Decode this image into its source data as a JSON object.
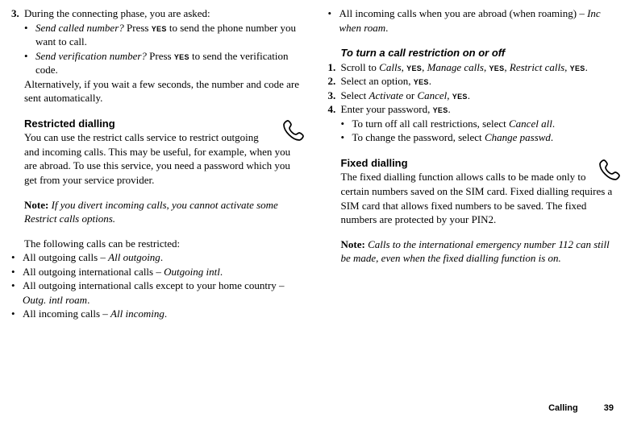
{
  "yes_label": "YES",
  "left": {
    "step3_num": "3.",
    "step3_lead": "During the connecting phase, you are asked:",
    "step3_b1_q": "Send called number?",
    "step3_b1_rest_a": " Press ",
    "step3_b1_rest_b": " to send the phone number you want to call.",
    "step3_b2_q": "Send verification number?",
    "step3_b2_rest_a": " Press ",
    "step3_b2_rest_b": " to send the verification code.",
    "step3_alt": "Alternatively, if you wait a few seconds, the number and code are sent automatically.",
    "rd_heading": "Restricted dialling",
    "rd_body": "You can use the restrict calls service to restrict outgoing and incoming calls. This may be useful, for example, when you are abroad. To use this service, you need a password which you get from your service provider.",
    "rd_note_label": "Note:",
    "rd_note_text": " If you divert incoming calls, you cannot activate some Restrict calls options.",
    "rd_list_intro": "The following calls can be restricted:",
    "rd_items": [
      {
        "t": "All outgoing calls – ",
        "i": "All outgoing",
        "end": "."
      },
      {
        "t": "All outgoing international calls – ",
        "i": "Outgoing intl",
        "end": "."
      },
      {
        "t": "All outgoing international calls except to your home country – ",
        "i": "Outg. intl roam",
        "end": "."
      },
      {
        "t": "All incoming calls – ",
        "i": "All incoming",
        "end": "."
      }
    ]
  },
  "right": {
    "roam_t": "All incoming calls when you are abroad (when roaming) – ",
    "roam_i": "Inc when roam",
    "roam_end": ".",
    "proc_heading": "To turn a call restriction on or off",
    "s1_num": "1.",
    "s1_a": "Scroll to ",
    "s1_calls": "Calls",
    "s1_b": ", ",
    "s1_manage": "Manage calls",
    "s1_c": ", ",
    "s1_restrict": "Restrict calls",
    "s1_d": ", ",
    "s1_end": ".",
    "s2_num": "2.",
    "s2_a": "Select an option, ",
    "s2_end": ".",
    "s3_num": "3.",
    "s3_a": "Select ",
    "s3_activate": "Activate",
    "s3_or": " or ",
    "s3_cancel": "Cancel",
    "s3_c": ", ",
    "s3_end": ".",
    "s4_num": "4.",
    "s4_a": "Enter your password, ",
    "s4_end": ".",
    "s4_sub1_a": "To turn off all call restrictions, select ",
    "s4_sub1_i": "Cancel all",
    "s4_sub1_end": ".",
    "s4_sub2_a": "To change the password, select ",
    "s4_sub2_i": "Change passwd",
    "s4_sub2_end": ".",
    "fd_heading": "Fixed dialling",
    "fd_body": "The fixed dialling function allows calls to be made only to certain numbers saved on the SIM card. Fixed dialling requires a SIM card that allows fixed numbers to be saved. The fixed numbers are protected by your PIN2.",
    "fd_note_label": "Note:",
    "fd_note_text": " Calls to the international emergency number 112 can still be made, even when the fixed dialling function is on."
  },
  "footer": {
    "section": "Calling",
    "page": "39"
  }
}
